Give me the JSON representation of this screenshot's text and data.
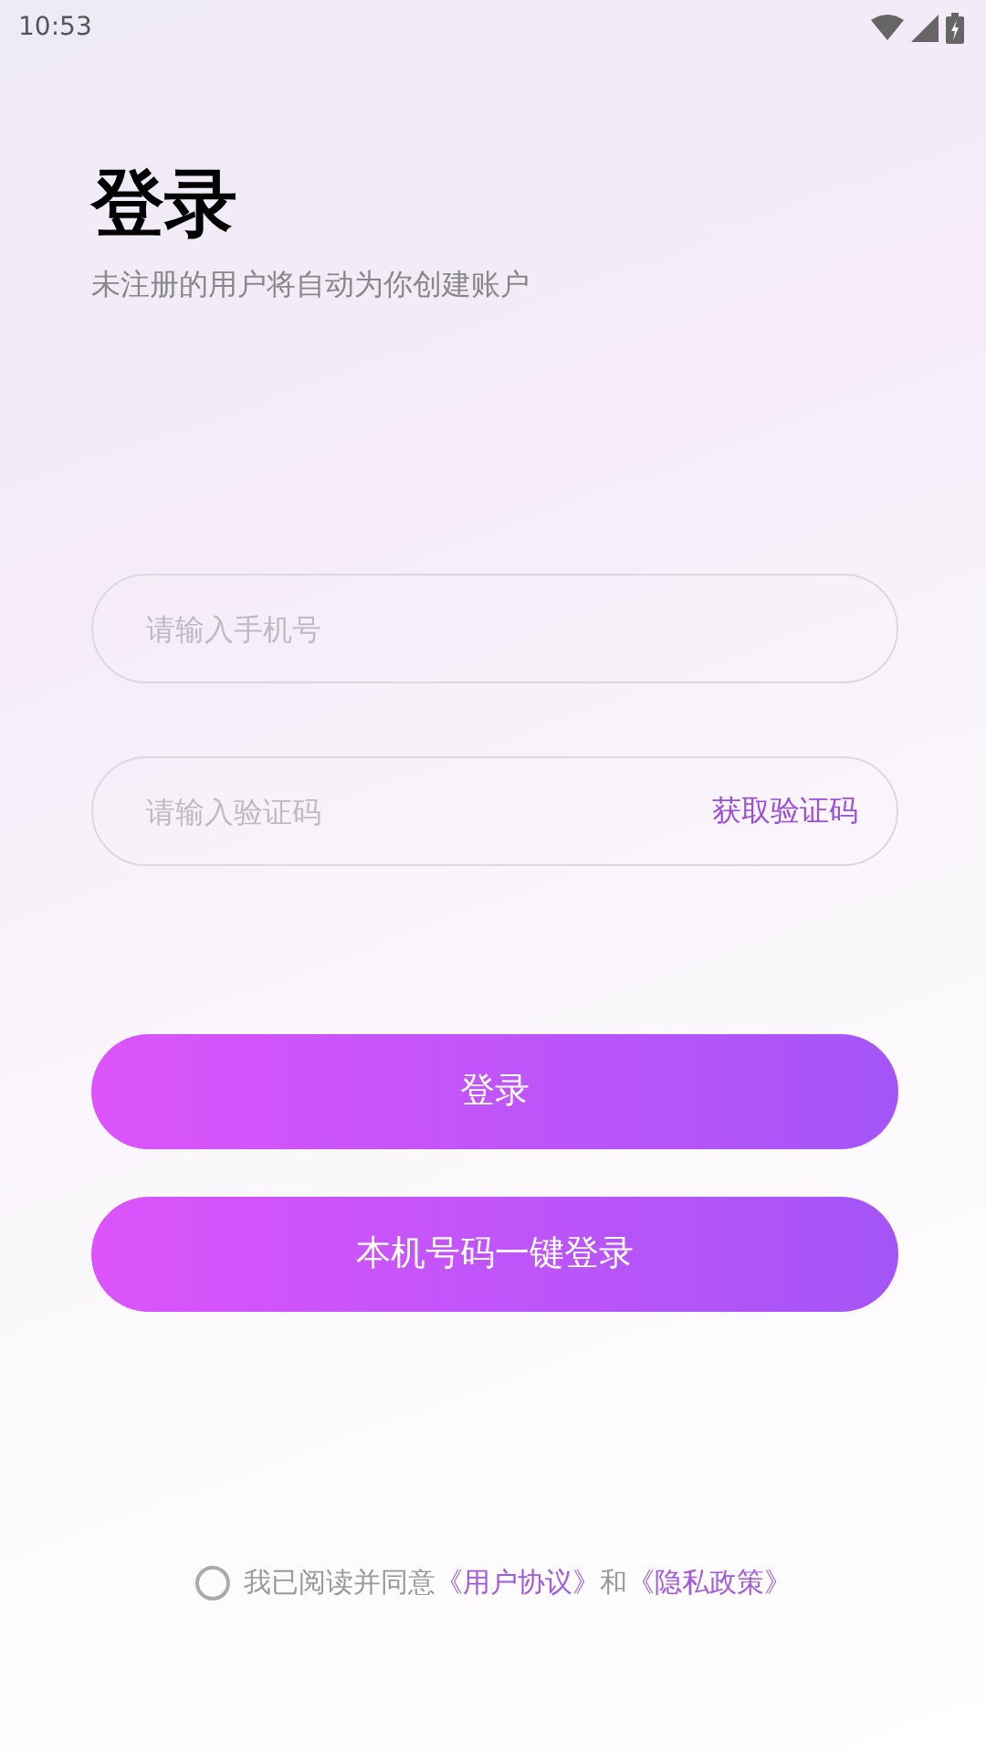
{
  "status_bar": {
    "time": "10:53"
  },
  "title": "登录",
  "subtitle": "未注册的用户将自动为你创建账户",
  "fields": [
    {
      "placeholder": "请输入手机号"
    },
    {
      "placeholder": "请输入验证码",
      "action": "获取验证码"
    }
  ],
  "buttons": [
    "登录",
    "本机号码一键登录"
  ],
  "agreement": {
    "checked": false,
    "parts": [
      {
        "kind": "text",
        "text": "我已阅读并同意"
      },
      {
        "kind": "link",
        "text": "《用户协议》"
      },
      {
        "kind": "text",
        "text": "和"
      },
      {
        "kind": "link",
        "text": "《隐私政策》"
      }
    ]
  }
}
